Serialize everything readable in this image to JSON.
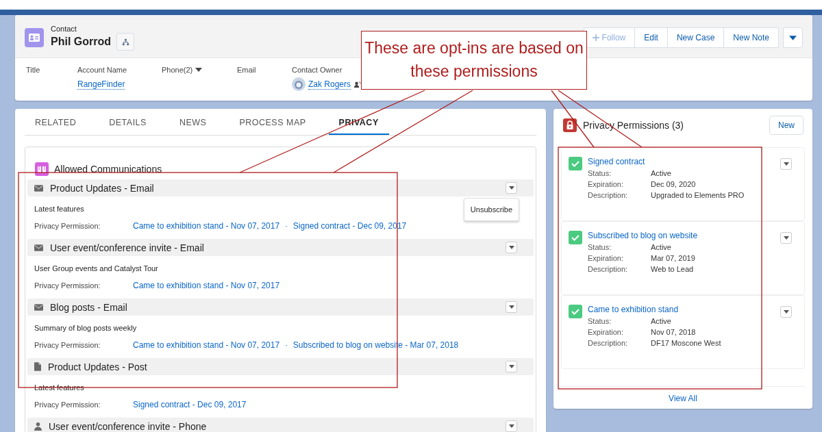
{
  "record": {
    "object_type": "Contact",
    "name": "Phil Gorrod",
    "actions": [
      {
        "label": "Follow",
        "kind": "follow"
      },
      {
        "label": "Edit",
        "kind": "plain"
      },
      {
        "label": "New Case",
        "kind": "plain"
      },
      {
        "label": "New Note",
        "kind": "plain"
      },
      {
        "kind": "menu"
      }
    ],
    "fields": [
      {
        "label": "Title",
        "kind": "plain"
      },
      {
        "label": "Account Name",
        "value": "RangeFinder",
        "kind": "link"
      },
      {
        "label": "Phone(2)",
        "kind": "dropdown"
      },
      {
        "label": "Email",
        "kind": "plain"
      },
      {
        "label": "Contact Owner",
        "value": "Zak Rogers",
        "kind": "owner"
      }
    ]
  },
  "tabs": [
    {
      "label": "RELATED",
      "selected": false
    },
    {
      "label": "DETAILS",
      "selected": false
    },
    {
      "label": "NEWS",
      "selected": false
    },
    {
      "label": "PROCESS MAP",
      "selected": false
    },
    {
      "label": "PRIVACY",
      "selected": true
    }
  ],
  "allowed_communications": {
    "title": "Allowed Communications",
    "items": [
      {
        "title": "Product Updates - Email",
        "kind": "email",
        "description": "Latest features",
        "permission_label": "Privacy Permission:",
        "permissions": [
          "Came to exhibition stand - Nov 07, 2017",
          "Signed contract - Dec 09, 2017"
        ],
        "separator": "·",
        "menu": {
          "open": true,
          "items": [
            "Unsubscribe"
          ]
        }
      },
      {
        "title": "User event/conference invite - Email",
        "kind": "email",
        "description": "User Group events and Catalyst Tour",
        "permission_label": "Privacy Permission:",
        "permissions": [
          "Came to exhibition stand - Nov 07, 2017"
        ]
      },
      {
        "title": "Blog posts - Email",
        "kind": "email",
        "description": "Summary of blog posts weekly",
        "permission_label": "Privacy Permission:",
        "permissions": [
          "Came to exhibition stand - Nov 07, 2017",
          "Subscribed to blog on website - Mar 07, 2018"
        ],
        "separator": "·"
      },
      {
        "title": "Product Updates - Post",
        "kind": "post",
        "description": "Latest features",
        "permission_label": "Privacy Permission:",
        "permissions": [
          "Signed contract - Dec 09, 2017"
        ]
      },
      {
        "title": "User event/conference invite - Phone",
        "kind": "phone"
      }
    ]
  },
  "privacy_permissions": {
    "title": "Privacy Permissions (3)",
    "new_button": "New",
    "view_all": "View All",
    "items": [
      {
        "name": "Signed contract",
        "checked": true,
        "fields": [
          {
            "label": "Status:",
            "value": "Active"
          },
          {
            "label": "Expiration:",
            "value": "Dec 09, 2020"
          },
          {
            "label": "Description:",
            "value": "Upgraded to Elements PRO"
          }
        ]
      },
      {
        "name": "Subscribed to blog on website",
        "checked": true,
        "fields": [
          {
            "label": "Status:",
            "value": "Active"
          },
          {
            "label": "Expiration:",
            "value": "Mar 07, 2019"
          },
          {
            "label": "Description:",
            "value": "Web to Lead"
          }
        ]
      },
      {
        "name": "Came to exhibition stand",
        "checked": true,
        "fields": [
          {
            "label": "Status:",
            "value": "Active"
          },
          {
            "label": "Expiration:",
            "value": "Nov 07, 2018"
          },
          {
            "label": "Description:",
            "value": "DF17 Moscone West"
          }
        ]
      }
    ]
  },
  "callout": {
    "text": "These are opt-ins are based on these permissions"
  }
}
